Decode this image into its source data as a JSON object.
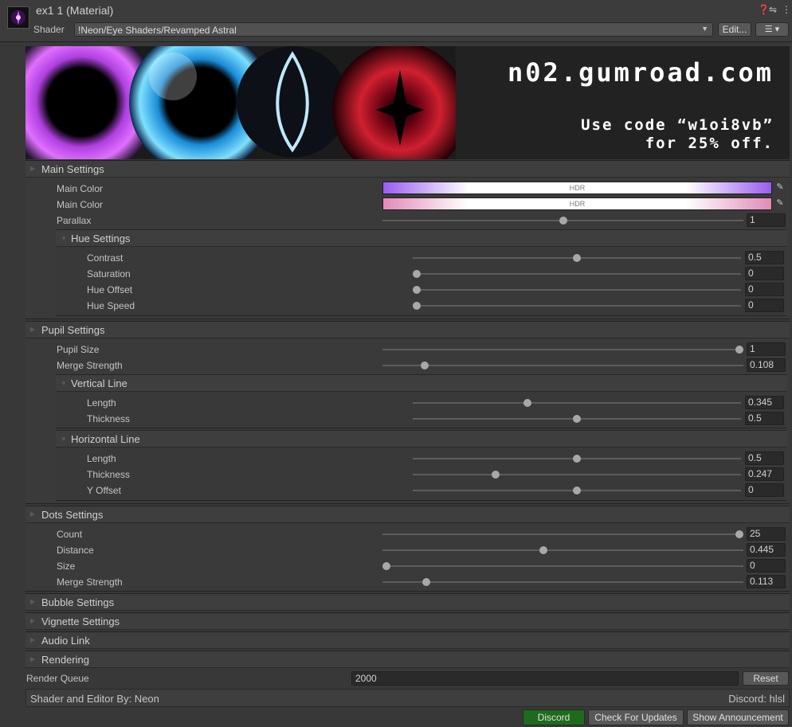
{
  "header": {
    "title": "ex1 1 (Material)",
    "shader_label": "Shader",
    "shader_value": "!Neon/Eye Shaders/Revamped Astral",
    "edit_label": "Edit...",
    "menu_glyph": "☰ ▾",
    "icons": [
      "help-icon",
      "preset-icon",
      "more-icon"
    ]
  },
  "banner": {
    "line1": "n02.gumroad.com",
    "line2": "Use code “w1oi8vb”",
    "line3": "for 25% off."
  },
  "sections": {
    "main": {
      "title": "Main Settings",
      "props": [
        {
          "label": "Main Color",
          "kind": "color",
          "hdr": "HDR",
          "color": "#9a5cf0"
        },
        {
          "label": "Main Color",
          "kind": "color",
          "hdr": "HDR",
          "color": "#e38ab8"
        },
        {
          "label": "Parallax",
          "kind": "slider",
          "value": "1",
          "fraction": 0.5
        }
      ],
      "hue": {
        "title": "Hue Settings",
        "props": [
          {
            "label": "Contrast",
            "value": "0.5",
            "fraction": 0.5
          },
          {
            "label": "Saturation",
            "value": "0",
            "fraction": 0
          },
          {
            "label": "Hue Offset",
            "value": "0",
            "fraction": 0
          },
          {
            "label": "Hue Speed",
            "value": "0",
            "fraction": 0
          }
        ]
      }
    },
    "pupil": {
      "title": "Pupil Settings",
      "props": [
        {
          "label": "Pupil Size",
          "value": "1",
          "fraction": 1
        },
        {
          "label": "Merge Strength",
          "value": "0.108",
          "fraction": 0.108
        }
      ],
      "vertical": {
        "title": "Vertical Line",
        "props": [
          {
            "label": "Length",
            "value": "0.345",
            "fraction": 0.345
          },
          {
            "label": "Thickness",
            "value": "0.5",
            "fraction": 0.5
          }
        ]
      },
      "horizontal": {
        "title": "Horizontal Line",
        "props": [
          {
            "label": "Length",
            "value": "0.5",
            "fraction": 0.5
          },
          {
            "label": "Thickness",
            "value": "0.247",
            "fraction": 0.247
          },
          {
            "label": "Y Offset",
            "value": "0",
            "fraction": 0.5
          }
        ]
      }
    },
    "dots": {
      "title": "Dots Settings",
      "props": [
        {
          "label": "Count",
          "value": "25",
          "fraction": 1
        },
        {
          "label": "Distance",
          "value": "0.445",
          "fraction": 0.445
        },
        {
          "label": "Size",
          "value": "0",
          "fraction": 0
        },
        {
          "label": "Merge Strength",
          "value": "0.113",
          "fraction": 0.113
        }
      ]
    },
    "collapsed": [
      "Bubble Settings",
      "Vignette Settings",
      "Audio Link",
      "Rendering"
    ]
  },
  "render_queue": {
    "label": "Render Queue",
    "value": "2000",
    "reset_label": "Reset"
  },
  "credits": {
    "left": "Shader and Editor By: Neon",
    "right": "Discord: hlsl"
  },
  "footer_buttons": {
    "discord": "Discord",
    "updates": "Check For Updates",
    "announcement": "Show Announcement",
    "discord_color": "#1e6b1e"
  }
}
